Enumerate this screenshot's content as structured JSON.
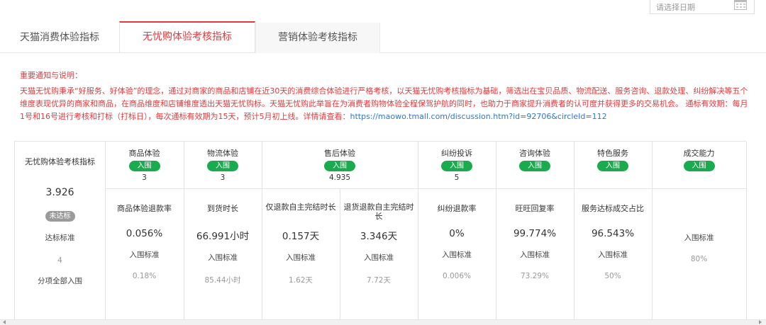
{
  "datepicker": {
    "placeholder": "请选择日期"
  },
  "tabs": [
    {
      "label": "天猫消费体验指标"
    },
    {
      "label": "无忧购体验考核指标"
    },
    {
      "label": "营销体验考核指标"
    }
  ],
  "notice": {
    "title": "重要通知与说明：",
    "body": "天猫无忧购秉承“好服务、好体验”的理念，通过对商家的商品和店铺在近30天的消费综合体验进行严格考核，以天猫无忧购考核指标为基础，筛选出在宝贝品质、物流配送、服务咨询、退款处理、纠纷解决等五个维度表现优异的商家和商品，在商品维度和店铺维度透出天猫无忧购标。天猫无忧购此举旨在为消费者购物体验全程保驾护航的同时，也助力于商家提升消费者的认可度并获得更多的交易机会。 通标有效期：每月1号和16号进行考核和打标（打标日），每次通标有效期为15天，预计5月初上线。详情请查看：",
    "link": "https://maowo.tmall.com/discussion.htm?id=92706&circleId=112"
  },
  "table": {
    "corner_title": "无忧购体验考核指标",
    "overall_score": "3.926",
    "overall_badge": "未达标",
    "label_standard": "达标标准",
    "standard_value": "4",
    "label_all_pass": "分项全部入围",
    "categories": [
      {
        "name": "商品体验",
        "badge": "入围",
        "score": "3"
      },
      {
        "name": "物流体验",
        "badge": "入围",
        "score": "3"
      },
      {
        "name": "售后体验",
        "badge": "入围",
        "score": "4.935"
      },
      {
        "name": "纠纷投诉",
        "badge": "入围",
        "score": "5"
      },
      {
        "name": "咨询体验",
        "badge": "入围",
        "score": ""
      },
      {
        "name": "特色服务",
        "badge": "入围",
        "score": ""
      },
      {
        "name": "成交能力",
        "badge": "入围",
        "score": ""
      }
    ],
    "metrics": [
      {
        "name": "商品体验退款率",
        "value": "0.056%",
        "std_label": "入围标准",
        "threshold": "0.18%"
      },
      {
        "name": "到货时长",
        "value": "66.991小时",
        "std_label": "入围标准",
        "threshold": "85.44小时"
      },
      {
        "name": "仅退款自主完结时长",
        "value": "0.157天",
        "std_label": "入围标准",
        "threshold": "1.62天"
      },
      {
        "name": "退货退款自主完结时长",
        "value": "3.346天",
        "std_label": "入围标准",
        "threshold": "7.72天"
      },
      {
        "name": "纠纷退款率",
        "value": "0%",
        "std_label": "入围标准",
        "threshold": "0.006%"
      },
      {
        "name": "旺旺回复率",
        "value": "99.774%",
        "std_label": "入围标准",
        "threshold": "73.29%"
      },
      {
        "name": "服务达标成交占比",
        "value": "96.543%",
        "std_label": "入围标准",
        "threshold": "50%"
      },
      {
        "name": "",
        "value": "",
        "std_label": "入围标准",
        "threshold": "80%"
      }
    ]
  },
  "colors": {
    "accent": "#e4393c",
    "badge_green": "#1aab4e",
    "badge_gray": "#9b9b9b",
    "link": "#3377cc"
  }
}
